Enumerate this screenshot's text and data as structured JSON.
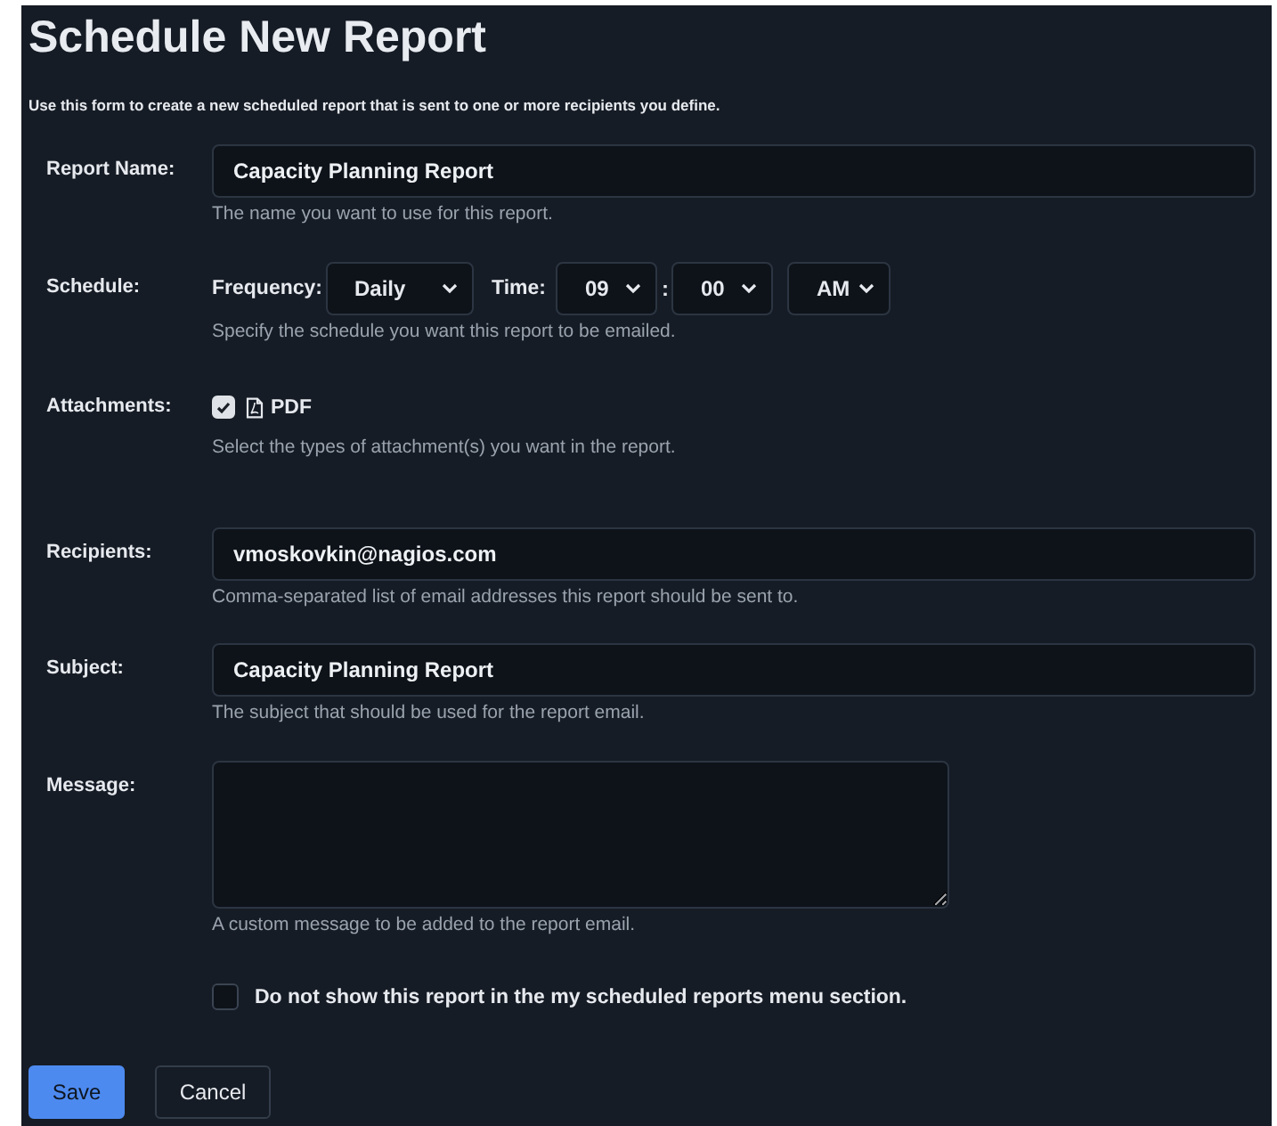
{
  "title": "Schedule New Report",
  "description": "Use this form to create a new scheduled report that is sent to one or more recipients you define.",
  "report_name": {
    "label": "Report Name:",
    "value": "Capacity Planning Report",
    "hint": "The name you want to use for this report."
  },
  "schedule": {
    "label": "Schedule:",
    "frequency_label": "Frequency:",
    "frequency": "Daily",
    "time_label": "Time:",
    "hour": "09",
    "separator": ":",
    "minute": "00",
    "ampm": "AM",
    "hint": "Specify the schedule you want this report to be emailed."
  },
  "attachments": {
    "label": "Attachments:",
    "options": [
      {
        "label": "PDF",
        "checked": true
      }
    ],
    "hint": "Select the types of attachment(s) you want in the report."
  },
  "recipients": {
    "label": "Recipients:",
    "value": "vmoskovkin@nagios.com",
    "hint": "Comma-separated list of email addresses this report should be sent to."
  },
  "subject": {
    "label": "Subject:",
    "value": "Capacity Planning Report",
    "hint": "The subject that should be used for the report email."
  },
  "message": {
    "label": "Message:",
    "hint": "A custom message to be added to the report email."
  },
  "hide_option": {
    "label": "Do not show this report in the my scheduled reports menu section.",
    "checked": false
  },
  "buttons": [
    {
      "label": "Save",
      "kind": "primary"
    },
    {
      "label": "Cancel",
      "kind": "secondary"
    }
  ]
}
